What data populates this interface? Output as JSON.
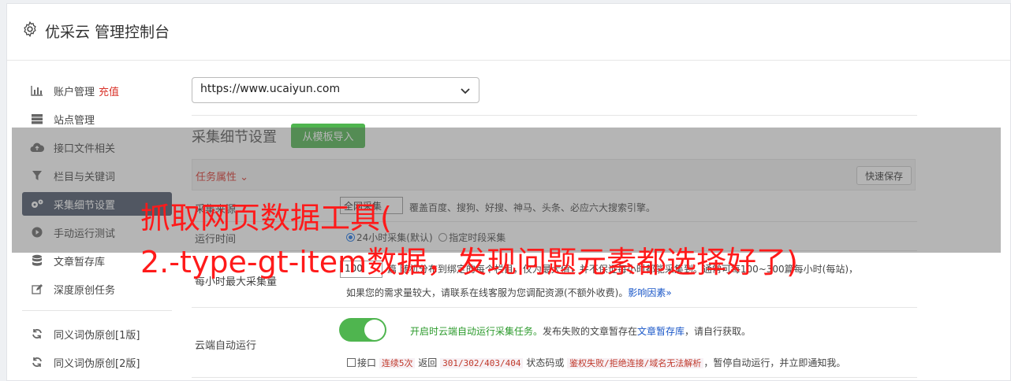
{
  "header": {
    "title": "优采云 管理控制台",
    "icon": "gear-icon"
  },
  "sidebar": {
    "items": [
      {
        "label": "账户管理",
        "icon": "bar-chart-icon",
        "badge": "充值"
      },
      {
        "label": "站点管理",
        "icon": "server-icon"
      },
      {
        "label": "接口文件相关",
        "icon": "cloud-upload-icon"
      },
      {
        "label": "栏目与关键词",
        "icon": "filter-icon"
      },
      {
        "label": "采集细节设置",
        "icon": "gears-icon",
        "active": true
      },
      {
        "label": "手动运行测试",
        "icon": "play-circle-icon"
      },
      {
        "label": "文章暂存库",
        "icon": "database-icon"
      },
      {
        "label": "深度原创任务",
        "icon": "edit-icon"
      },
      {
        "label": "同义词伪原创[1版]",
        "icon": "refresh-icon"
      },
      {
        "label": "同义词伪原创[2版]",
        "icon": "refresh-icon"
      }
    ]
  },
  "main": {
    "site_select": "https://www.ucaiyun.com",
    "section_title": "采集细节设置",
    "import_button": "从模板导入",
    "task_attr": "任务属性 ⌄",
    "quick_save": "快速保存",
    "source": {
      "label": "采集来源",
      "select_value": "全网采集",
      "desc": "覆盖百度、搜狗、好搜、神马、头条、必应六大搜索引擎。"
    },
    "run_time": {
      "label": "运行时间",
      "opt1": "24小时采集(默认)",
      "opt2": "指定时段采集"
    },
    "max_per_hour": {
      "label": "每小时最大采集量",
      "value": "100",
      "desc1": "篇 随机分布到绑定的每个栏目，仅为最大值，并不保证每小时都能采集到。通常可每100~300篇每小时(每站)，",
      "desc2": "如果您的需求量较大，请联系在线客服为您调配资源(不额外收费)。",
      "link": "影响因素»"
    },
    "cloud_run": {
      "label": "云端自动运行",
      "green_text": "开启时云端自动运行采集任务。",
      "text_a": "发布失败的文章暂存在",
      "link": "文章暂存库",
      "text_b": "，请自行获取。",
      "cb_label": "接口",
      "code1": "连续5次",
      "text_c": "返回",
      "code2": "301/302/403/404",
      "text_d": "状态码或",
      "code3": "鉴权失败/拒绝连接/域名无法解析",
      "text_e": "，暂停自动运行，并立即通知我。"
    }
  },
  "overlay": {
    "line1": "抓取网页数据工具(",
    "line2": "2.-type-gt-item数据，发现问题元素都选择好了)"
  }
}
